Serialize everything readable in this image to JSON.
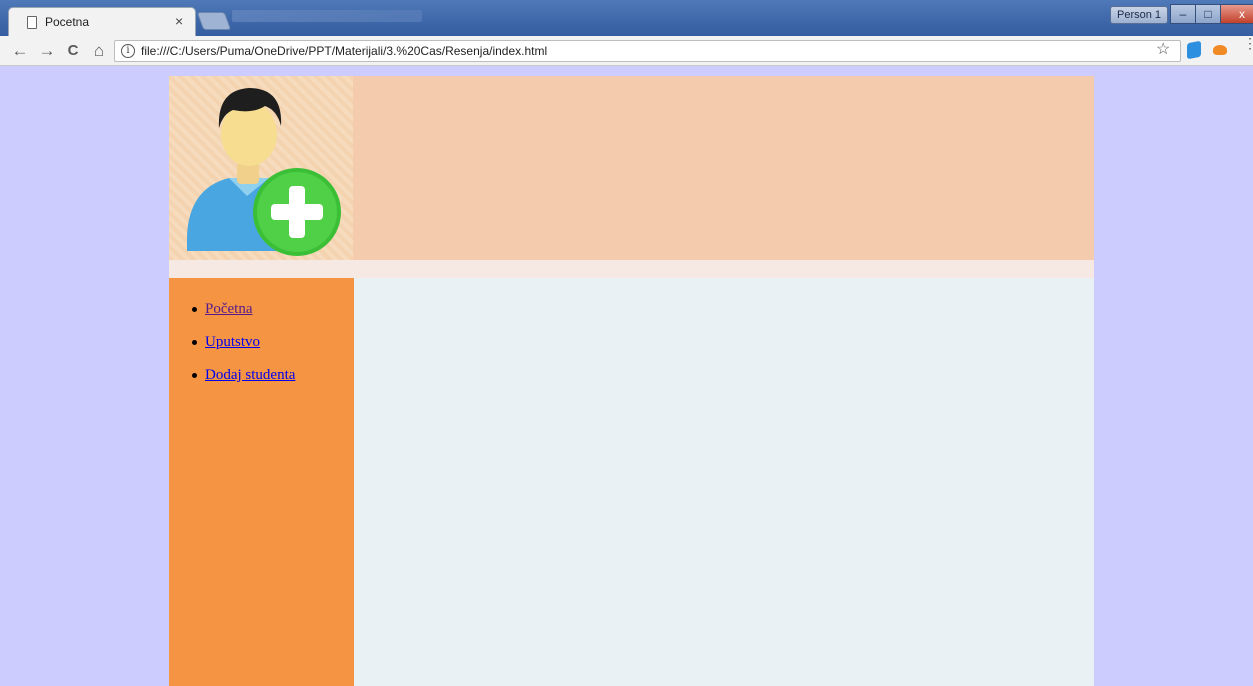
{
  "browser": {
    "tab_title": "Pocetna",
    "tab_close": "×",
    "profile": "Person 1",
    "window_controls": {
      "minimize": "–",
      "maximize": "□",
      "close": "x"
    },
    "nav": {
      "back": "←",
      "forward": "→",
      "reload": "C",
      "home": "⌂"
    },
    "info_glyph": "i",
    "url": "file:///C:/Users/Puma/OneDrive/PPT/Materijali/3.%20Cas/Resenja/index.html",
    "star": "☆",
    "menu": "⋮"
  },
  "page": {
    "background": "#ccccff",
    "header_color": "#f4cbad",
    "sidebar_color": "#f59443",
    "main_color": "#e9f1f4",
    "logo_icon": "add-user-icon",
    "nav_items": [
      {
        "label": "Početna",
        "state": "visited"
      },
      {
        "label": "Uputstvo",
        "state": "link"
      },
      {
        "label": "Dodaj studenta",
        "state": "link"
      }
    ]
  }
}
